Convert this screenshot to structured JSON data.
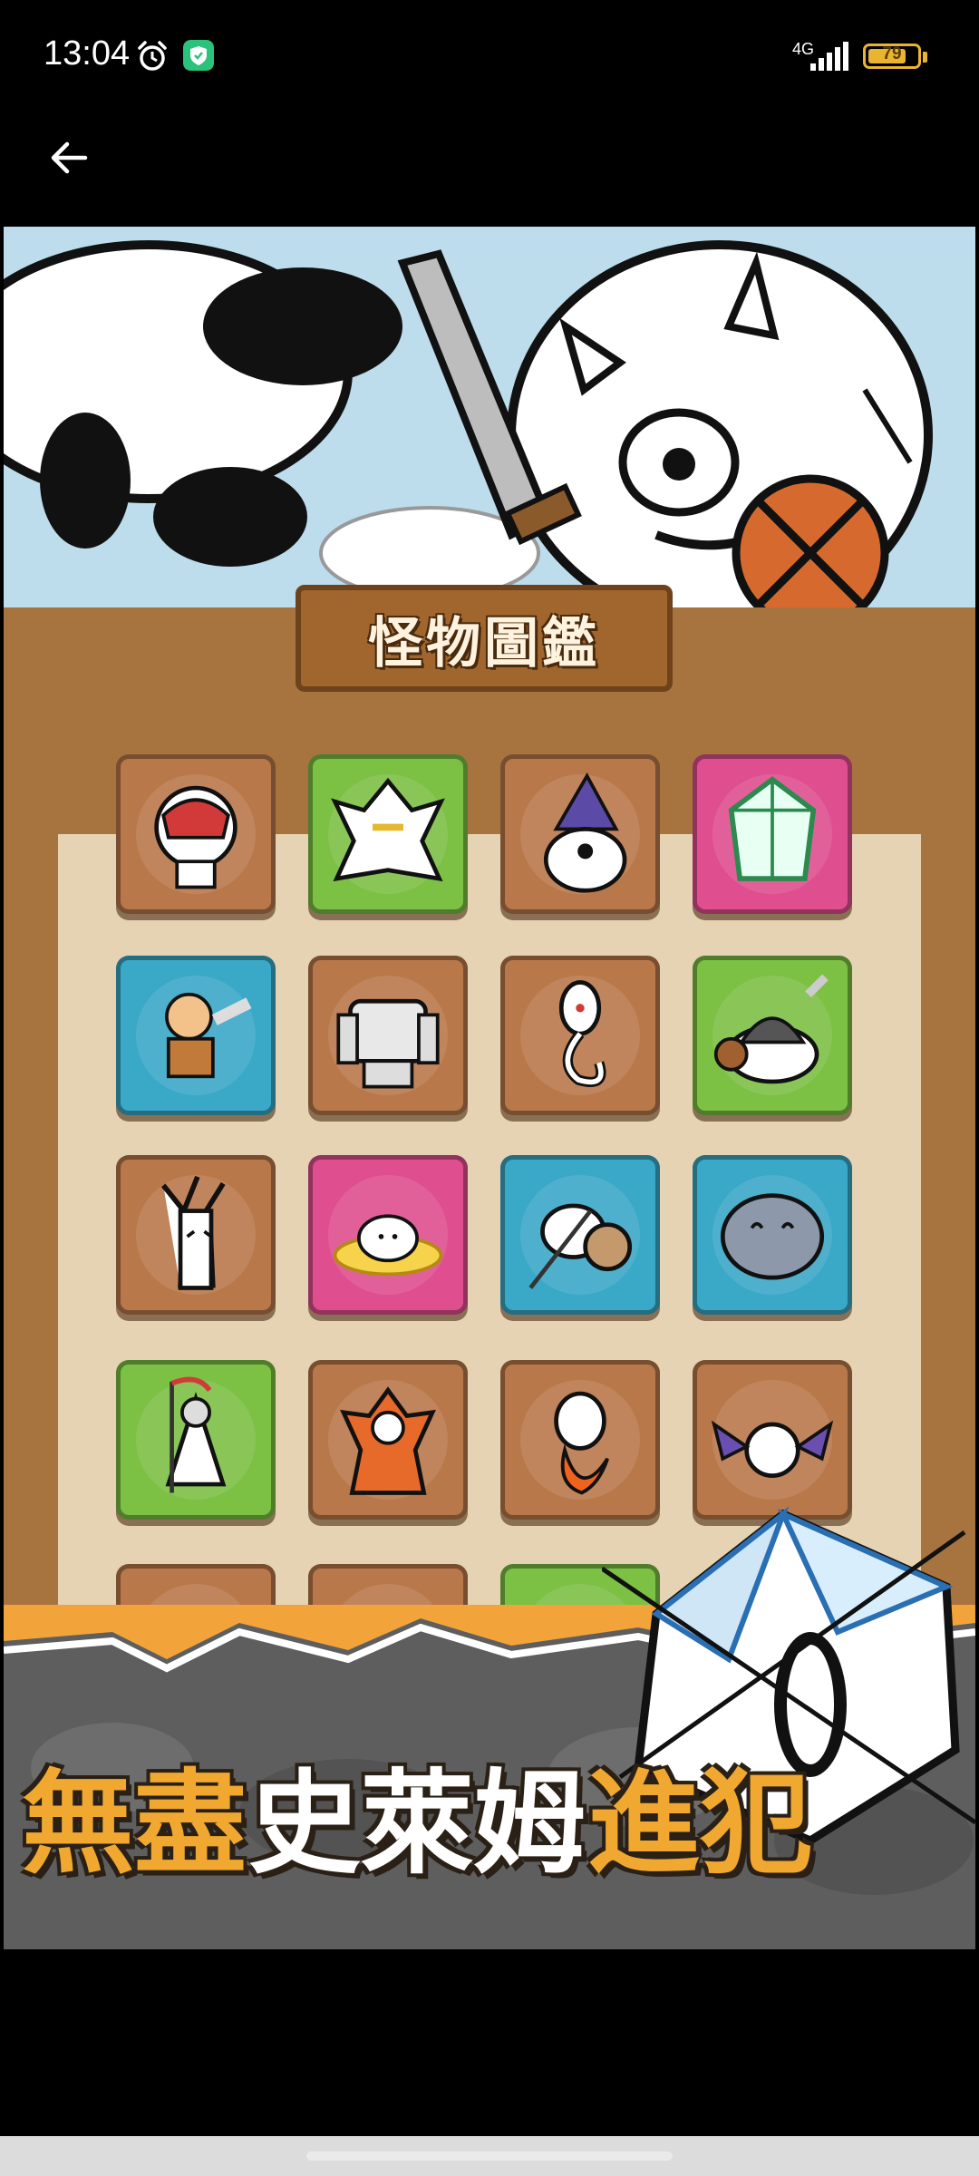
{
  "status_bar": {
    "time": "13:04",
    "network": "4G",
    "battery_level": "79",
    "battery_fraction": 0.79,
    "icons": [
      "alarm-icon",
      "shield-check-icon",
      "signal-icon",
      "battery-icon"
    ]
  },
  "app_bar": {
    "back_icon": "arrow-left-icon"
  },
  "game": {
    "board_title": "怪物圖鑑",
    "slogan_parts": [
      "無盡",
      "史萊姆",
      "進犯"
    ],
    "tile_colors": {
      "brown": "#b9784a",
      "green": "#7cc044",
      "pink": "#df4f8f",
      "blue": "#3aa8c7"
    },
    "tiles": [
      {
        "row": 1,
        "col": 1,
        "color": "brown",
        "monster": "red-mask-robot"
      },
      {
        "row": 1,
        "col": 2,
        "color": "green",
        "monster": "white-armored-knight"
      },
      {
        "row": 1,
        "col": 3,
        "color": "brown",
        "monster": "wizard-slime"
      },
      {
        "row": 1,
        "col": 4,
        "color": "pink",
        "monster": "crystal-golem"
      },
      {
        "row": 2,
        "col": 1,
        "color": "blue",
        "monster": "bald-monk"
      },
      {
        "row": 2,
        "col": 2,
        "color": "brown",
        "monster": "stone-golem"
      },
      {
        "row": 2,
        "col": 3,
        "color": "brown",
        "monster": "ghost-snake"
      },
      {
        "row": 2,
        "col": 4,
        "color": "green",
        "monster": "helmet-slime-warrior"
      },
      {
        "row": 3,
        "col": 1,
        "color": "brown",
        "monster": "angry-tree"
      },
      {
        "row": 3,
        "col": 2,
        "color": "pink",
        "monster": "melted-slime"
      },
      {
        "row": 3,
        "col": 3,
        "color": "blue",
        "monster": "shield-spearman"
      },
      {
        "row": 3,
        "col": 4,
        "color": "blue",
        "monster": "gray-blob"
      },
      {
        "row": 4,
        "col": 1,
        "color": "green",
        "monster": "grim-reaper"
      },
      {
        "row": 4,
        "col": 2,
        "color": "brown",
        "monster": "fire-demon"
      },
      {
        "row": 4,
        "col": 3,
        "color": "brown",
        "monster": "flame-spirit"
      },
      {
        "row": 4,
        "col": 4,
        "color": "brown",
        "monster": "bat-slime"
      },
      {
        "row": 5,
        "col": 1,
        "color": "brown",
        "monster": "hidden"
      },
      {
        "row": 5,
        "col": 2,
        "color": "brown",
        "monster": "hidden"
      },
      {
        "row": 5,
        "col": 3,
        "color": "green",
        "monster": "hidden"
      }
    ]
  }
}
